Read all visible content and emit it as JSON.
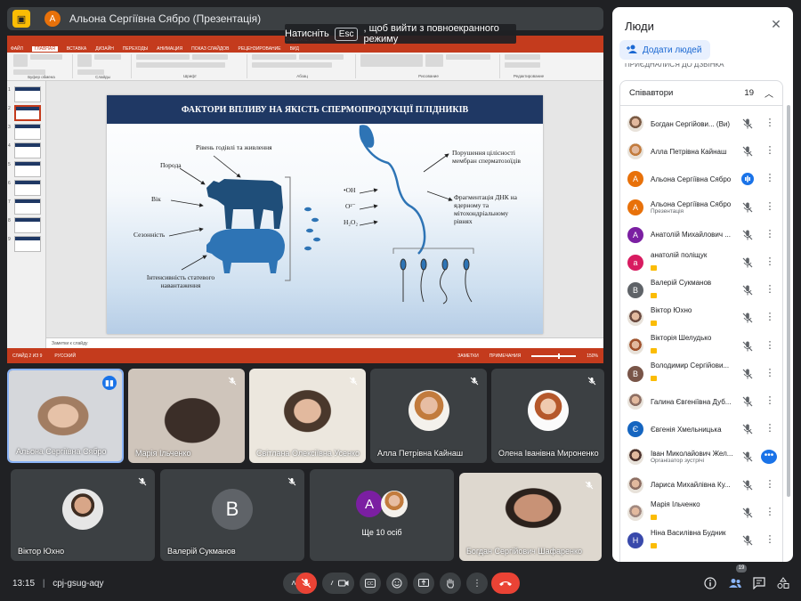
{
  "top_bar": {
    "presenter_initial": "А",
    "presenter_title": "Альона Сергіївна Сябро (Презентація)"
  },
  "fullscreen_hint": {
    "before": "Натисніть",
    "key": "Esc",
    "after": ", щоб вийти з повноекранного режиму"
  },
  "powerpoint": {
    "window_title": "Сябро А.С. 14.05...",
    "tabs": [
      "ФАЙЛ",
      "ГЛАВНАЯ",
      "ВСТАВКА",
      "ДИЗАЙН",
      "ПЕРЕХОДЫ",
      "АНИМАЦИЯ",
      "ПОКАЗ СЛАЙДОВ",
      "РЕЦЕНЗИРОВАНИЕ",
      "ВИД"
    ],
    "ribbon_groups": [
      "Буфер обмена",
      "Слайды",
      "Шрифт",
      "Абзац",
      "Рисование",
      "Редактирование"
    ],
    "notes_placeholder": "Заметки к слайду",
    "status_left": [
      "СЛАЙД 2 ИЗ 9",
      "РУССКИЙ"
    ],
    "status_right": [
      "ЗАМЕТКИ",
      "ПРИМЕЧАНИЯ",
      "150%"
    ],
    "slide_numbers": [
      "1",
      "2",
      "3",
      "4",
      "5",
      "6",
      "7",
      "8",
      "9"
    ]
  },
  "slide": {
    "title": "ФАКТОРИ ВПЛИВУ НА ЯКІСТЬ СПЕРМОПРОДУКЦІЇ ПЛІДНИКІВ",
    "labels": {
      "feeding": "Рівень годівлі та живлення",
      "breed": "Порода",
      "age": "Вік",
      "season": "Сезонність",
      "intensity": "Інтенсивність статевого навантаження",
      "oh": "•OH",
      "o2": "O²⁻",
      "h2o2": "H₂O₂",
      "membrane": "Порушення цілісності мембран сперматозоїдів",
      "dna": "Фрагментація ДНК на ядерному та мітохондріальному рівнях"
    }
  },
  "tiles": [
    {
      "name": "Альона Сергіївна Сябро",
      "mic": "speaking"
    },
    {
      "name": "Марія Ільченко",
      "mic": "muted"
    },
    {
      "name": "Світлана Олексіївна Усенко",
      "mic": "muted"
    },
    {
      "name": "Алла Петрівна Кайнаш",
      "mic": "muted"
    },
    {
      "name": "Олена Іванівна Мироненко",
      "mic": "muted"
    },
    {
      "name": "Віктор Юхно",
      "mic": "muted"
    },
    {
      "name": "Валерій Сукманов",
      "mic": "muted",
      "initial": "В"
    },
    {
      "name": "Ще 10 осіб",
      "initial": "А"
    },
    {
      "name": "Богдан Сергійович Шафаренко",
      "mic": "muted"
    }
  ],
  "people": {
    "title": "Люди",
    "add_label": "Додати людей",
    "clipped_label": "ПРИЄДНАЛИСЯ ДО ДЗВІНКА",
    "section_label": "Співавтори",
    "count": "19",
    "list": [
      {
        "name": "Богдан Сергійови... (Ви)",
        "sub": ""
      },
      {
        "name": "Алла Петрівна Кайнаш",
        "sub": ""
      },
      {
        "name": "Альона Сергіївна Сябро",
        "sub": "",
        "mic": "speaking",
        "initial": "А"
      },
      {
        "name": "Альона Сергіївна Сябро",
        "sub": "Презентація",
        "initial": "А"
      },
      {
        "name": "Анатолій Михайлович ...",
        "sub": "",
        "initial": "А"
      },
      {
        "name": "анатолій поліщук",
        "sub": "",
        "initial": "а"
      },
      {
        "name": "Валерій Сукманов",
        "sub": "",
        "initial": "В"
      },
      {
        "name": "Віктор Юхно",
        "sub": ""
      },
      {
        "name": "Вікторія Шелудько",
        "sub": ""
      },
      {
        "name": "Володимир Сергійови...",
        "sub": "",
        "initial": "В"
      },
      {
        "name": "Галина Євгеніївна Дуб...",
        "sub": ""
      },
      {
        "name": "Євгенія Хмельницька",
        "sub": "",
        "initial": "Є"
      },
      {
        "name": "Іван Миколайович Жел...",
        "sub": "Організатор зустрічі"
      },
      {
        "name": "Лариса Михайлівна Ку...",
        "sub": ""
      },
      {
        "name": "Марія Ільченко",
        "sub": ""
      },
      {
        "name": "Ніна Василівна Будник",
        "sub": "",
        "initial": "Н"
      }
    ]
  },
  "bottom_bar": {
    "time": "13:15",
    "separator": "|",
    "meeting_code": "cpj-gsug-aqy",
    "participants_badge": "19"
  },
  "colors": {
    "background": "#202124",
    "tile": "#3c4043",
    "accent_blue": "#1a73e8",
    "end_call_red": "#ea4335",
    "slide_header": "#1f3864",
    "ppt_red": "#c43b1d"
  }
}
